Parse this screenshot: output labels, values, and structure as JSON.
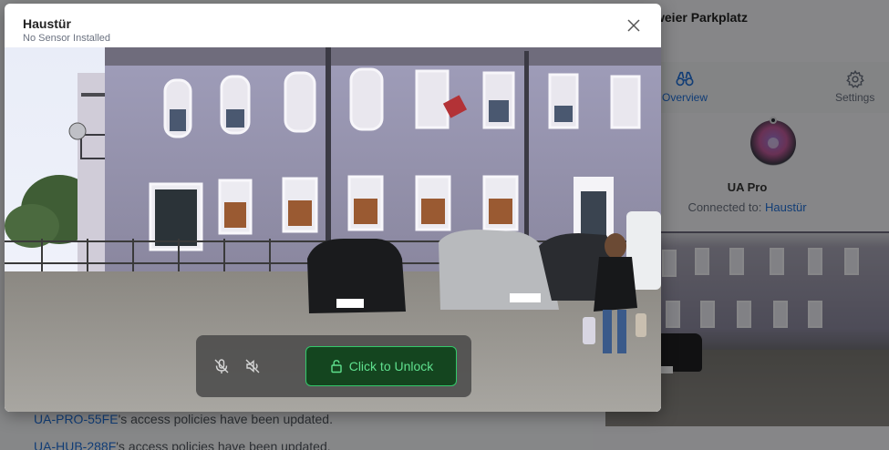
{
  "background": {
    "log_lines": [
      {
        "link": "UA-PRO-55FE",
        "text": "'s access policies have been updated."
      },
      {
        "link": "UA-HUB-288F",
        "text": "'s access policies have been updated."
      }
    ],
    "panel": {
      "title": "weier Parkplatz",
      "tabs": [
        {
          "label": "Overview",
          "icon": "binoculars-icon",
          "active": true
        },
        {
          "label": "Settings",
          "icon": "gear-icon",
          "active": false
        }
      ],
      "device": {
        "name": "UA Pro",
        "connected_label": "Connected to:",
        "connected_value": "Haustür"
      }
    }
  },
  "modal": {
    "title": "Haustür",
    "subtitle": "No Sensor Installed",
    "close_icon": "close-icon",
    "controls": {
      "mic_icon": "mic-muted-icon",
      "speaker_icon": "speaker-muted-icon",
      "unlock_label": "Click to Unlock",
      "unlock_icon": "lock-icon",
      "accent": "#33c86a"
    }
  }
}
